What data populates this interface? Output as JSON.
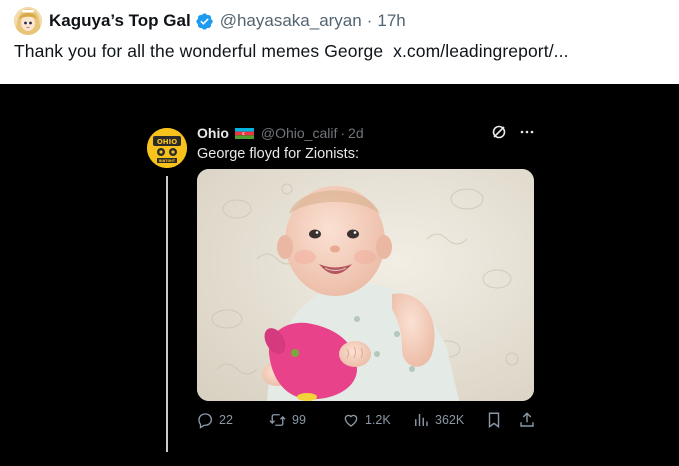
{
  "outer_post": {
    "display_name": "Kaguya’s Top Gal",
    "handle": "@hayasaka_aryan",
    "separator": "·",
    "time": "17h",
    "text": "Thank you for all the wonderful memes George",
    "link": "x.com/leadingreport/..."
  },
  "inner_post": {
    "display_name": "Ohio",
    "handle": "@Ohio_calif",
    "separator": "·",
    "time": "2d",
    "text": "George floyd for Zionists:",
    "avatar_text": [
      "OHIO",
      "BINTOHT"
    ],
    "stats": {
      "replies": "22",
      "reposts": "99",
      "likes": "1.2K",
      "views": "362K"
    }
  },
  "icons": [
    "verified-badge-icon",
    "azerbaijan-flag-icon",
    "grok-icon",
    "more-icon",
    "reply-icon",
    "repost-icon",
    "like-icon",
    "views-icon",
    "bookmark-icon",
    "share-icon"
  ],
  "colors": {
    "verified_blue": "#1d9bf0",
    "dark_background": "#000000",
    "dark_text": "#e7e9ea",
    "dark_muted": "#71767b"
  }
}
